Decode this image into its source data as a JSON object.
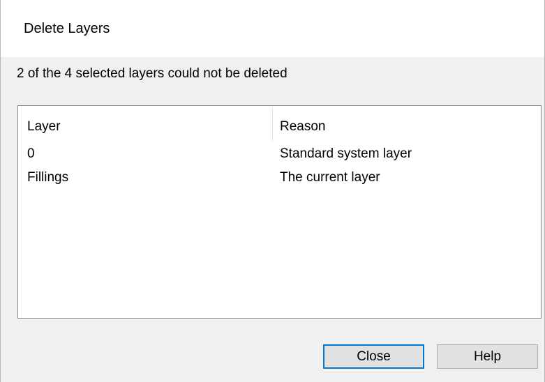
{
  "window": {
    "title": "Delete Layers"
  },
  "message": "2 of the 4 selected layers could not be deleted",
  "table": {
    "columns": [
      "Layer",
      "Reason"
    ],
    "rows": [
      {
        "layer": "0",
        "reason": "Standard system layer"
      },
      {
        "layer": "Fillings",
        "reason": "The current layer"
      }
    ]
  },
  "buttons": {
    "close_label": "Close",
    "help_label": "Help"
  },
  "colors": {
    "focus_border": "#0078d7",
    "button_face": "#e1e1e1",
    "dialog_background": "#f0f0f0"
  }
}
